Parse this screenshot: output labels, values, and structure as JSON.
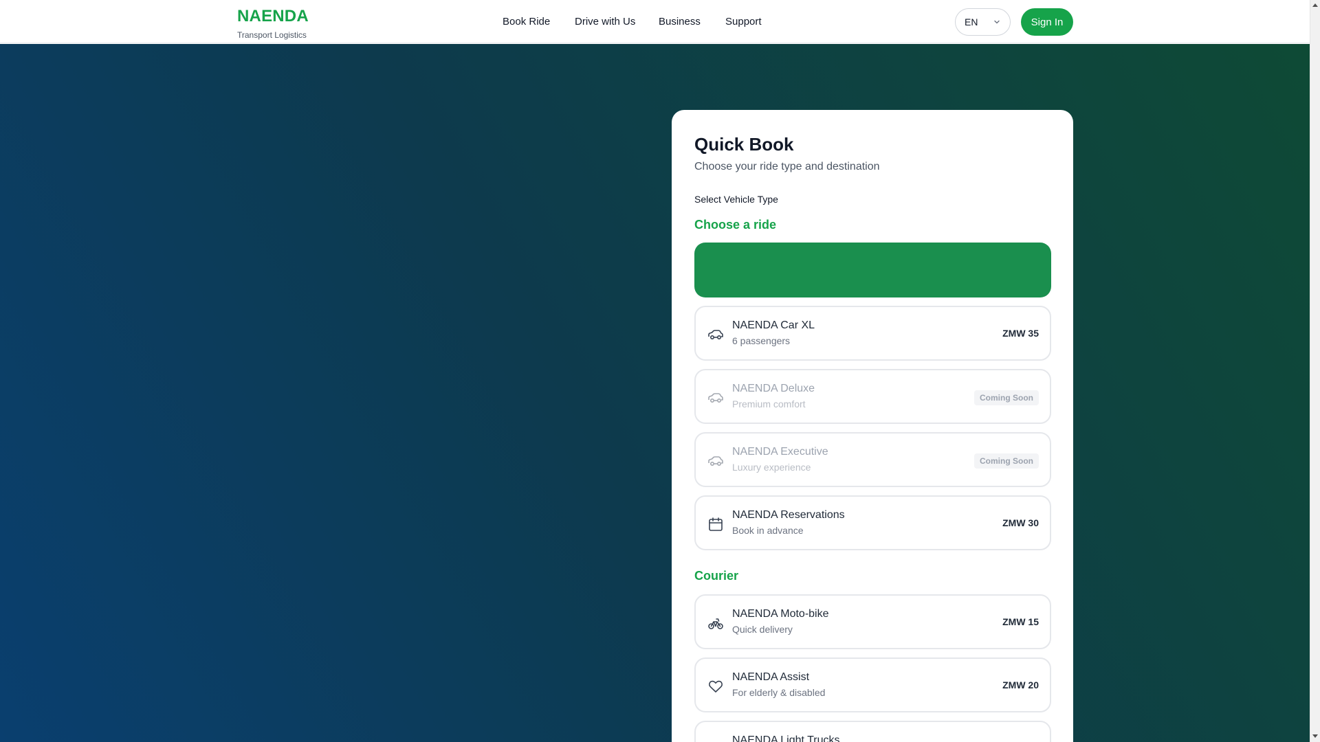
{
  "header": {
    "brand": "NAENDA",
    "tagline": "Transport Logistics",
    "nav": [
      "Book Ride",
      "Drive with Us",
      "Business",
      "Support"
    ],
    "language": "EN",
    "sign_in": "Sign In"
  },
  "quick_book": {
    "title": "Quick Book",
    "subtitle": "Choose your ride type and destination",
    "select_label": "Select Vehicle Type",
    "ride_section": "Choose a ride",
    "courier_section": "Courier",
    "rides": [
      {
        "name": "NAENDA Car XL",
        "desc": "6 passengers",
        "price": "ZMW 35",
        "icon": "car-icon"
      },
      {
        "name": "NAENDA Deluxe",
        "desc": "Premium comfort",
        "badge": "Coming Soon",
        "icon": "car-icon"
      },
      {
        "name": "NAENDA Executive",
        "desc": "Luxury experience",
        "badge": "Coming Soon",
        "icon": "car-icon"
      },
      {
        "name": "NAENDA Reservations",
        "desc": "Book in advance",
        "price": "ZMW 30",
        "icon": "calendar-icon"
      }
    ],
    "courier": [
      {
        "name": "NAENDA Moto-bike",
        "desc": "Quick delivery",
        "price": "ZMW 15",
        "icon": "bike-icon"
      },
      {
        "name": "NAENDA Assist",
        "desc": "For elderly & disabled",
        "price": "ZMW 20",
        "icon": "heart-icon"
      },
      {
        "name": "NAENDA Light Trucks",
        "icon": "truck-icon"
      }
    ]
  },
  "colors": {
    "accent": "#16a34a",
    "banner": "#1a8f4e"
  }
}
